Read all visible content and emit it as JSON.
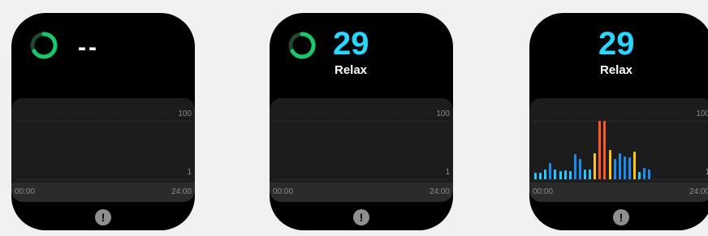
{
  "colors": {
    "accent_value": "#29d6ff",
    "spinner": "#19c86a",
    "level_relax_cyan": "#28c6ff",
    "level_relax_blue": "#1d8cf0",
    "level_normal_yellow": "#ffc21a",
    "level_high_orange": "#ff5722"
  },
  "screens": [
    {
      "id": "loading",
      "value": "--",
      "label": "",
      "y_max": "100",
      "y_min": "1",
      "x_start": "00:00",
      "x_end": "24:00",
      "alert_icon": "exclamation-icon"
    },
    {
      "id": "measured",
      "value": "29",
      "label": "Relax",
      "y_max": "100",
      "y_min": "1",
      "x_start": "00:00",
      "x_end": "24:00",
      "alert_icon": "exclamation-icon"
    },
    {
      "id": "with-history",
      "value": "29",
      "label": "Relax",
      "y_max": "100",
      "y_min": "1",
      "x_start": "00:00",
      "x_end": "24:00",
      "alert_icon": "exclamation-icon"
    }
  ],
  "chart_data": {
    "type": "bar",
    "ylim": [
      1,
      100
    ],
    "values": [
      12,
      12,
      18,
      28,
      17,
      15,
      16,
      15,
      44,
      35,
      17,
      17,
      45,
      100,
      100,
      50,
      35,
      45,
      40,
      38,
      48,
      14,
      20,
      17
    ],
    "levels": [
      "cyan",
      "cyan",
      "cyan",
      "blue",
      "cyan",
      "cyan",
      "cyan",
      "cyan",
      "blue",
      "blue",
      "cyan",
      "cyan",
      "yellow",
      "orange",
      "orange",
      "yellow",
      "blue",
      "blue",
      "blue",
      "blue",
      "yellow",
      "cyan",
      "blue",
      "blue"
    ]
  }
}
